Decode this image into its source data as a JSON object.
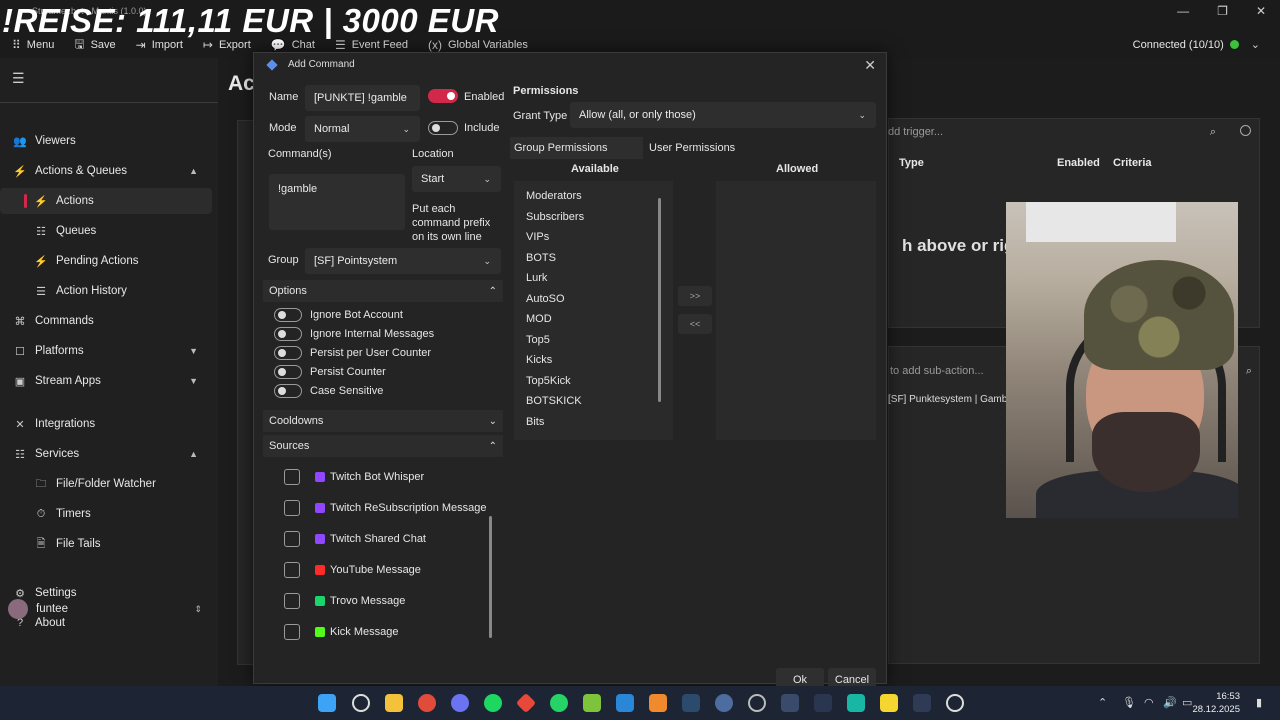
{
  "overlay": {
    "title": "!REISE: 111,11 EUR | 3000 EUR"
  },
  "window": {
    "title": "Streamer.bot - Mantis (1.0.0)",
    "controls": [
      "—",
      "❐",
      "✕"
    ]
  },
  "menubar": [
    {
      "icon": "menu-icon",
      "glyph": "⠿",
      "label": "Menu"
    },
    {
      "icon": "save-icon",
      "glyph": "🖫",
      "label": "Save"
    },
    {
      "icon": "import-icon",
      "glyph": "⇥",
      "label": "Import"
    },
    {
      "icon": "export-icon",
      "glyph": "↦",
      "label": "Export"
    },
    {
      "icon": "chat-icon",
      "glyph": "💬",
      "label": "Chat"
    },
    {
      "icon": "event-feed-icon",
      "glyph": "☰",
      "label": "Event Feed"
    },
    {
      "icon": "variable-icon",
      "glyph": "(x)",
      "label": "Global Variables"
    }
  ],
  "connection": {
    "label": "Connected (10/10)",
    "status_color": "#3cc13b"
  },
  "sidebar": {
    "items": [
      {
        "label": "Viewers",
        "glyph": "👥",
        "level": 0,
        "chev": ""
      },
      {
        "label": "Actions & Queues",
        "glyph": "⚡",
        "level": 0,
        "chev": "▲"
      },
      {
        "label": "Actions",
        "glyph": "⚡",
        "level": 1,
        "chev": "",
        "active": true
      },
      {
        "label": "Queues",
        "glyph": "☷",
        "level": 1,
        "chev": ""
      },
      {
        "label": "Pending Actions",
        "glyph": "⚡",
        "level": 1,
        "chev": ""
      },
      {
        "label": "Action History",
        "glyph": "☰",
        "level": 1,
        "chev": ""
      },
      {
        "label": "Commands",
        "glyph": "⌘",
        "level": 0,
        "chev": ""
      },
      {
        "label": "Platforms",
        "glyph": "☐",
        "level": 0,
        "chev": "▼"
      },
      {
        "label": "Stream Apps",
        "glyph": "▣",
        "level": 0,
        "chev": "▼"
      },
      {
        "label": "Integrations",
        "glyph": "✕",
        "level": 0,
        "chev": ""
      },
      {
        "label": "Services",
        "glyph": "☷",
        "level": 0,
        "chev": "▲"
      },
      {
        "label": "File/Folder Watcher",
        "glyph": "🗀",
        "level": 1,
        "chev": ""
      },
      {
        "label": "Timers",
        "glyph": "⏱",
        "level": 1,
        "chev": ""
      },
      {
        "label": "File Tails",
        "glyph": "🗎",
        "level": 1,
        "chev": ""
      },
      {
        "label": "Settings",
        "glyph": "⚙",
        "level": 0,
        "chev": ""
      },
      {
        "label": "About",
        "glyph": "?",
        "level": 0,
        "chev": ""
      }
    ],
    "user": {
      "name": "funtee"
    }
  },
  "background": {
    "page_title": "Ac",
    "tab_partial": "Act",
    "trigger_search_placeholder": "dd trigger...",
    "trigger_columns": [
      "Type",
      "Enabled",
      "Criteria"
    ],
    "hint": "h above or righ",
    "subaction_placeholder": "to add sub-action...",
    "subaction_row": "[SF] Punktesystem | Gamble"
  },
  "dialog": {
    "title": "Add Command",
    "name_label": "Name",
    "name_value": "[PUNKTE] !gamble",
    "enabled_label": "Enabled",
    "enabled": true,
    "mode_label": "Mode",
    "mode_value": "Normal",
    "include_label": "Include",
    "include": false,
    "commands_label": "Command(s)",
    "commands_value": "!gamble",
    "location_label": "Location",
    "location_value": "Start",
    "location_hint": [
      "Put each",
      "command prefix",
      "on its own line"
    ],
    "group_label": "Group",
    "group_value": "[SF] Pointsystem",
    "options_header": "Options",
    "options": [
      "Ignore Bot Account",
      "Ignore Internal Messages",
      "Persist per User Counter",
      "Persist Counter",
      "Case Sensitive"
    ],
    "cooldowns_header": "Cooldowns",
    "sources_header": "Sources",
    "sources": [
      {
        "label": "Twitch Bot Whisper",
        "icon": "twitch-icon",
        "color": "#9146ff"
      },
      {
        "label": "Twitch ReSubscription Message",
        "icon": "twitch-icon",
        "color": "#9146ff"
      },
      {
        "label": "Twitch Shared Chat",
        "icon": "twitch-icon",
        "color": "#9146ff"
      },
      {
        "label": "YouTube Message",
        "icon": "youtube-icon",
        "color": "#ff2b2b"
      },
      {
        "label": "Trovo Message",
        "icon": "trovo-icon",
        "color": "#19d66b"
      },
      {
        "label": "Kick Message",
        "icon": "kick-icon",
        "color": "#53fc18"
      }
    ],
    "permissions": {
      "title": "Permissions",
      "grant_type_label": "Grant Type",
      "grant_type_value": "Allow (all, or only those)",
      "tabs": [
        "Group Permissions",
        "User Permissions"
      ],
      "available_label": "Available",
      "allowed_label": "Allowed",
      "available": [
        "Moderators",
        "Subscribers",
        "VIPs",
        "BOTS",
        "Lurk",
        "AutoSO",
        "MOD",
        "Top5",
        "Kicks",
        "Top5Kick",
        "BOTSKICK",
        "Bits"
      ],
      "allowed": [],
      "move_right": ">>",
      "move_left": "<<"
    },
    "ok_label": "Ok",
    "cancel_label": "Cancel"
  },
  "taskbar": {
    "time": "16:53",
    "date": "28.12.2025"
  }
}
